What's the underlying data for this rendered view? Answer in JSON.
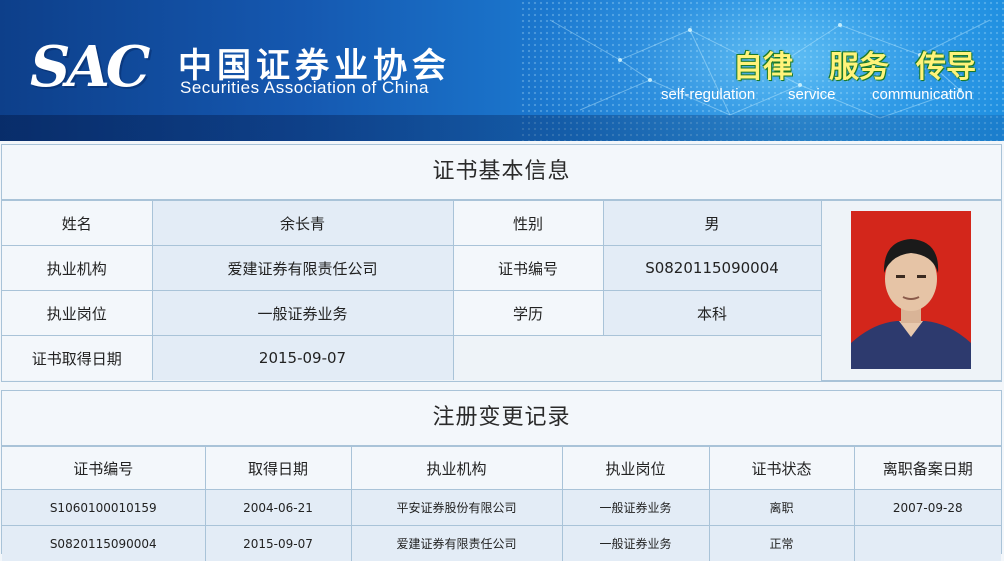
{
  "header": {
    "logo_mark": "SAC",
    "org_name_cn": "中国证券业协会",
    "org_name_en": "Securities Association of China",
    "slogans": [
      {
        "cn": "自律",
        "en": "self-regulation"
      },
      {
        "cn": "服务",
        "en": "service"
      },
      {
        "cn": "传导",
        "en": "communication"
      }
    ]
  },
  "basic_info": {
    "title": "证书基本信息",
    "name_label": "姓名",
    "name_value": "余长青",
    "gender_label": "性别",
    "gender_value": "男",
    "institution_label": "执业机构",
    "institution_value": "爱建证券有限责任公司",
    "cert_no_label": "证书编号",
    "cert_no_value": "S0820115090004",
    "position_label": "执业岗位",
    "position_value": "一般证券业务",
    "education_label": "学历",
    "education_value": "本科",
    "cert_date_label": "证书取得日期",
    "cert_date_value": "2015-09-07",
    "photo_icon": "person-portrait-icon"
  },
  "change_records": {
    "title": "注册变更记录",
    "columns": [
      "证书编号",
      "取得日期",
      "执业机构",
      "执业岗位",
      "证书状态",
      "离职备案日期"
    ],
    "rows": [
      [
        "S1060100010159",
        "2004-06-21",
        "平安证券股份有限公司",
        "一般证券业务",
        "离职",
        "2007-09-28"
      ],
      [
        "S0820115090004",
        "2015-09-07",
        "爱建证券有限责任公司",
        "一般证券业务",
        "正常",
        ""
      ]
    ]
  },
  "colors": {
    "banner_dark": "#0d3f8a",
    "banner_light": "#2a9ae6",
    "border": "#a9c3d8",
    "cell_value_bg": "#e3ecf6",
    "slogan_text": "#fff37a",
    "photo_bg": "#d82a1e"
  }
}
